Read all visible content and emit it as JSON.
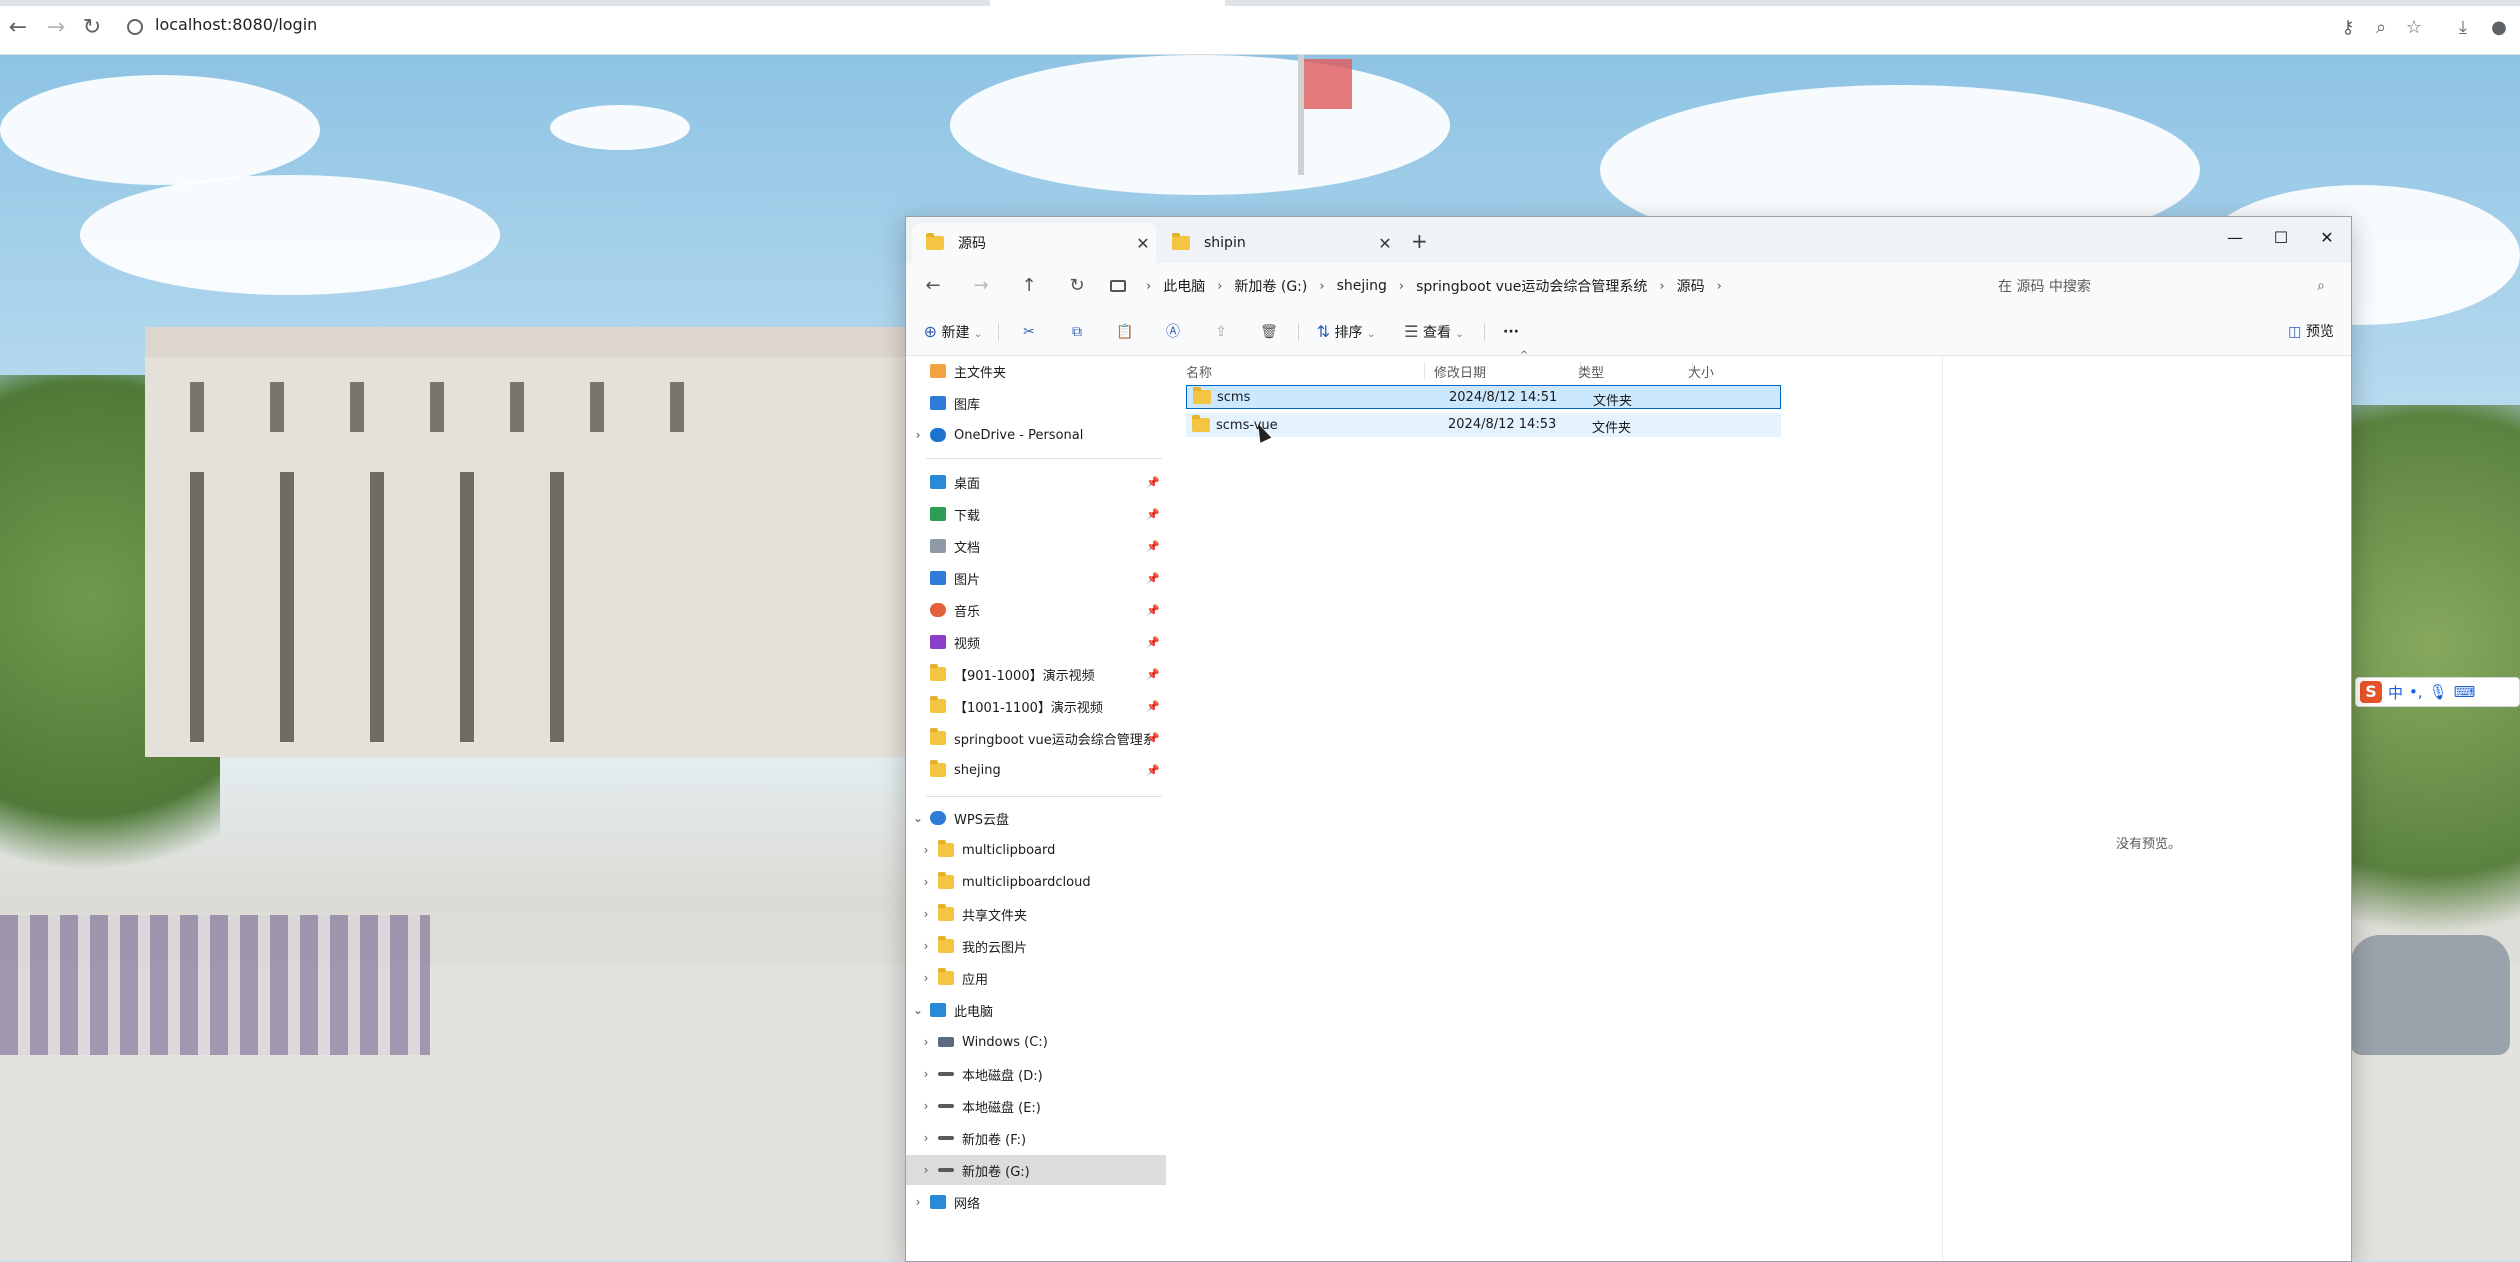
{
  "browser": {
    "url": "localhost:8080/login",
    "nav": {
      "back_icon": "back-arrow-icon",
      "forward_icon": "forward-arrow-icon",
      "reload_icon": "reload-icon"
    },
    "right_icons": [
      "key-icon",
      "zoom-icon",
      "star-icon",
      "download-icon",
      "profile-icon"
    ]
  },
  "ime": {
    "logo": "S",
    "lang": "中"
  },
  "explorer": {
    "tabs": [
      {
        "label": "源码",
        "active": true
      },
      {
        "label": "shipin",
        "active": false
      }
    ],
    "breadcrumb": [
      "此电脑",
      "新加卷 (G:)",
      "shejing",
      "springboot vue运动会综合管理系统",
      "源码"
    ],
    "search_placeholder": "在 源码 中搜索",
    "toolbar": {
      "new_label": "新建",
      "sort_label": "排序",
      "view_label": "查看",
      "more_label": "···",
      "preview_label": "预览"
    },
    "columns": {
      "name": "名称",
      "modified": "修改日期",
      "type": "类型",
      "size": "大小"
    },
    "files": [
      {
        "name": "scms",
        "modified": "2024/8/12 14:51",
        "type": "文件夹",
        "size": ""
      },
      {
        "name": "scms-vue",
        "modified": "2024/8/12 14:53",
        "type": "文件夹",
        "size": ""
      }
    ],
    "preview_empty": "没有预览。",
    "nav_pane": {
      "top": [
        {
          "label": "主文件夹",
          "icon": "home-icon"
        },
        {
          "label": "图库",
          "icon": "gallery-icon"
        },
        {
          "label": "OneDrive - Personal",
          "icon": "cloud-icon"
        }
      ],
      "quick": [
        {
          "label": "桌面",
          "icon": "desktop-icon"
        },
        {
          "label": "下载",
          "icon": "download-icon"
        },
        {
          "label": "文档",
          "icon": "document-icon"
        },
        {
          "label": "图片",
          "icon": "pictures-icon"
        },
        {
          "label": "音乐",
          "icon": "music-icon"
        },
        {
          "label": "视频",
          "icon": "video-icon"
        },
        {
          "label": "【901-1000】演示视频",
          "icon": "folder-icon"
        },
        {
          "label": "【1001-1100】演示视频",
          "icon": "folder-icon"
        },
        {
          "label": "springboot vue运动会综合管理系统",
          "icon": "folder-icon"
        },
        {
          "label": "shejing",
          "icon": "folder-icon"
        }
      ],
      "wps": {
        "label": "WPS云盘",
        "icon": "wps-cloud-icon"
      },
      "wps_children": [
        "multiclipboard",
        "multiclipboardcloud",
        "共享文件夹",
        "我的云图片",
        "应用"
      ],
      "this_pc": {
        "label": "此电脑",
        "icon": "computer-icon"
      },
      "drives": [
        "Windows (C:)",
        "本地磁盘 (D:)",
        "本地磁盘 (E:)",
        "新加卷 (F:)",
        "新加卷 (G:)"
      ],
      "network": {
        "label": "网络",
        "icon": "network-icon"
      }
    }
  }
}
